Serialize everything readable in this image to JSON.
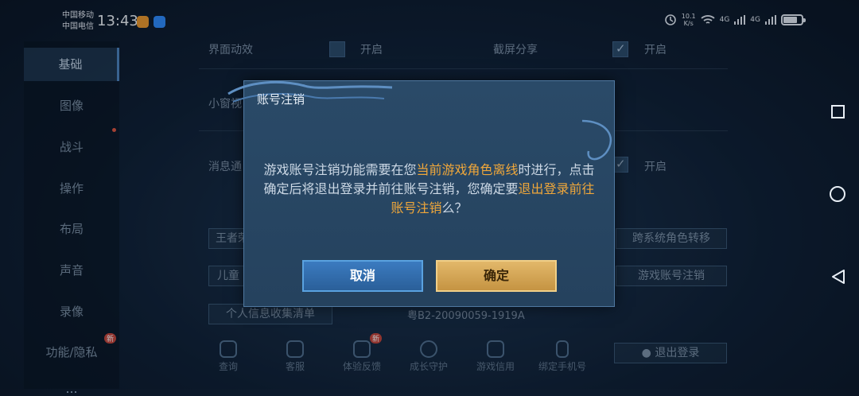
{
  "status_bar": {
    "carrier1": "中国移动",
    "carrier2": "中国电信",
    "time": "13:43",
    "net_speed_value": "10.1",
    "net_speed_unit": "K/s",
    "signal1": "4G",
    "signal2": "4G",
    "battery_level": 0.72,
    "icons": [
      "alarm-icon",
      "wifi-icon",
      "signal-icon",
      "signal-icon",
      "battery-icon"
    ]
  },
  "sidebar": {
    "items": [
      {
        "label": "基础"
      },
      {
        "label": "图像"
      },
      {
        "label": "战斗"
      },
      {
        "label": "操作"
      },
      {
        "label": "布局"
      },
      {
        "label": "声音"
      },
      {
        "label": "录像"
      },
      {
        "label": "功能/隐私"
      },
      {
        "label": "…"
      }
    ],
    "new_badge": "新"
  },
  "settings": {
    "row1_label": "界面动效",
    "row1_value": "开启",
    "row2_label": "截屏分享",
    "row2_value": "开启",
    "row3_label": "小窗视",
    "row4_label": "消息通",
    "row4_value": "开启",
    "btn_left1": "王者荣",
    "btn_right1": "跨系统角色转移",
    "btn_left2": "儿童",
    "btn_right2": "游戏账号注销",
    "privacy_list": "个人信息收集清单",
    "license": "粤B2-20090059-1919A",
    "logout": "退出登录",
    "bottom": [
      {
        "label": "查询"
      },
      {
        "label": "客服"
      },
      {
        "label": "体验反馈"
      },
      {
        "label": "成长守护"
      },
      {
        "label": "游戏信用"
      },
      {
        "label": "绑定手机号"
      }
    ]
  },
  "dialog": {
    "title": "账号注销",
    "msg_part1": "游戏账号注销功能需要在您",
    "msg_highlight1": "当前游戏角色离线",
    "msg_part2": "时进行，点击确定后将退出登录并前往账号注销，您确定要",
    "msg_highlight2": "退出登录前往账号注销",
    "msg_part3": "么？",
    "cancel_label": "取消",
    "confirm_label": "确定",
    "highlight_color": "#f0a73a"
  }
}
